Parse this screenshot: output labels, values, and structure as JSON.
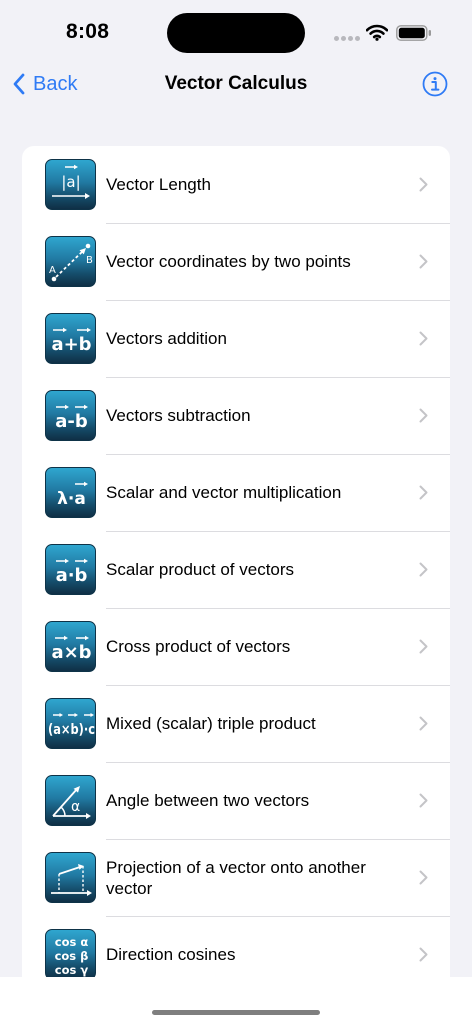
{
  "status_bar": {
    "time": "8:08"
  },
  "nav": {
    "back_label": "Back",
    "title": "Vector Calculus",
    "accent_color": "#2f7bf5"
  },
  "items": [
    {
      "label": "Vector Length",
      "icon": "vector-length-icon",
      "icon_text": "|a|"
    },
    {
      "label": "Vector coordinates by two points",
      "icon": "two-points-icon",
      "icon_text_a": "A",
      "icon_text_b": "B"
    },
    {
      "label": "Vectors addition",
      "icon": "vector-addition-icon",
      "icon_text": "a+b"
    },
    {
      "label": "Vectors subtraction",
      "icon": "vector-subtraction-icon",
      "icon_text": "a-b"
    },
    {
      "label": "Scalar and vector multiplication",
      "icon": "scalar-multiplication-icon",
      "icon_text": "λ·a"
    },
    {
      "label": "Scalar product of vectors",
      "icon": "dot-product-icon",
      "icon_text": "a·b"
    },
    {
      "label": "Cross product of vectors",
      "icon": "cross-product-icon",
      "icon_text": "a×b"
    },
    {
      "label": "Mixed (scalar) triple product",
      "icon": "triple-product-icon",
      "icon_text": "(a×b)·c"
    },
    {
      "label": "Angle between two vectors",
      "icon": "angle-icon",
      "icon_text": "α"
    },
    {
      "label": "Projection of a vector onto another vector",
      "icon": "projection-icon"
    },
    {
      "label": "Direction cosines",
      "icon": "direction-cosines-icon",
      "icon_lines": [
        "cos α",
        "cos β",
        "cos γ"
      ]
    }
  ]
}
